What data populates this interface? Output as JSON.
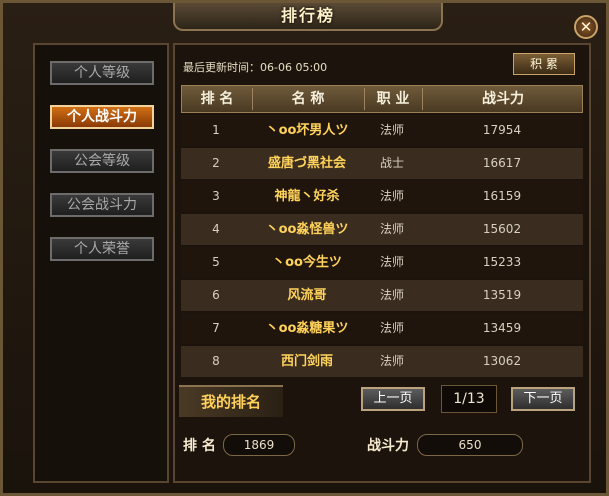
{
  "window": {
    "title": "排行榜",
    "close_label": "✕"
  },
  "sidebar": {
    "items": [
      {
        "label": "个人等级",
        "active": false
      },
      {
        "label": "个人战斗力",
        "active": true
      },
      {
        "label": "公会等级",
        "active": false
      },
      {
        "label": "公会战斗力",
        "active": false
      },
      {
        "label": "个人荣誉",
        "active": false
      }
    ]
  },
  "main": {
    "update_time": "最后更新时间：06-06 05:00",
    "honor_button": "积 累",
    "headers": {
      "rank": "排 名",
      "name": "名 称",
      "job": "职 业",
      "power": "战斗力"
    },
    "rows": [
      {
        "rank": "1",
        "name": "丶oo坏男人ツ",
        "job": "法师",
        "power": "17954"
      },
      {
        "rank": "2",
        "name": "盛唐づ黑社会",
        "job": "战士",
        "power": "16617"
      },
      {
        "rank": "3",
        "name": "神龍丶好杀",
        "job": "法师",
        "power": "16159"
      },
      {
        "rank": "4",
        "name": "丶oo淼怪兽ツ",
        "job": "法师",
        "power": "15602"
      },
      {
        "rank": "5",
        "name": "丶oo今生ツ",
        "job": "法师",
        "power": "15233"
      },
      {
        "rank": "6",
        "name": "风流哥",
        "job": "法师",
        "power": "13519"
      },
      {
        "rank": "7",
        "name": "丶oo淼糖果ツ",
        "job": "法师",
        "power": "13459"
      },
      {
        "rank": "8",
        "name": "西门剑雨",
        "job": "法师",
        "power": "13062"
      }
    ],
    "my_rank_label": "我的排名",
    "prev_page": "上一页",
    "next_page": "下一页",
    "page": "1/13",
    "my_rank_field_label": "排 名",
    "my_rank_value": "1869",
    "my_power_label": "战斗力",
    "my_power_value": "650"
  }
}
